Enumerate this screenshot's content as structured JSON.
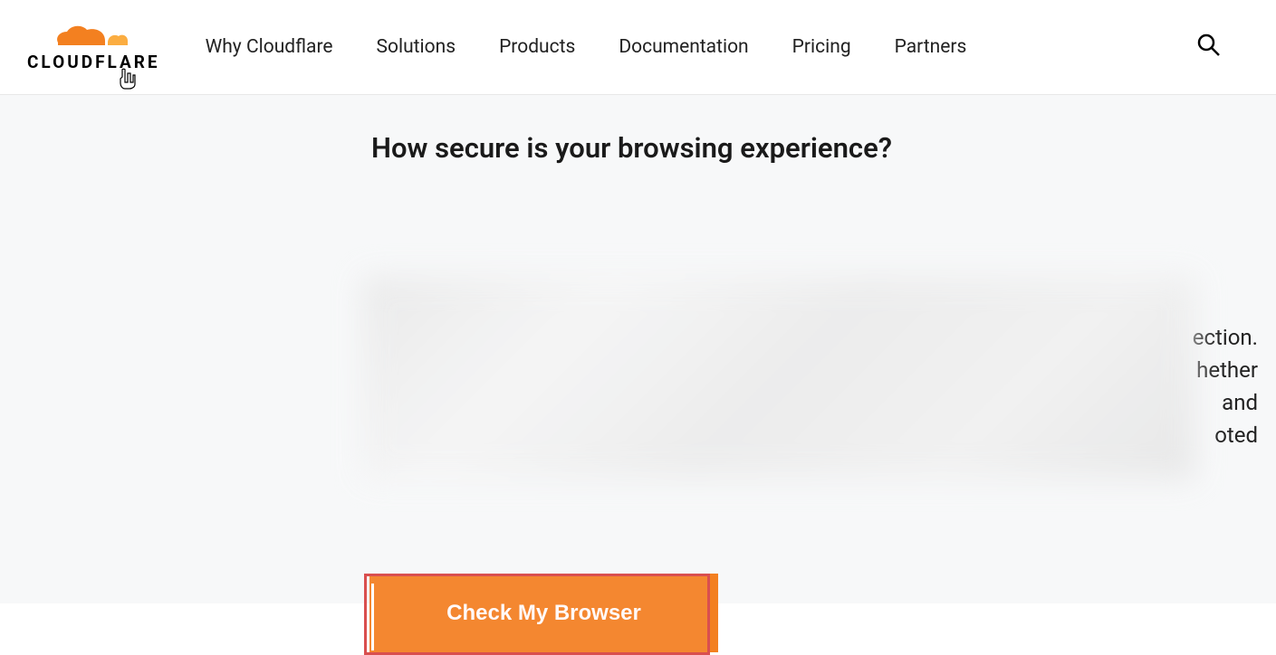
{
  "header": {
    "logo_text": "CLOUDFLARE",
    "nav": [
      "Why Cloudflare",
      "Solutions",
      "Products",
      "Documentation",
      "Pricing",
      "Partners"
    ]
  },
  "main": {
    "heading": "How secure is your browsing experience?",
    "partial_lines": [
      "ection.",
      "hether",
      "and",
      "oted"
    ],
    "cta_label": "Check My Browser"
  },
  "colors": {
    "accent": "#f38020",
    "highlight_border": "#d94f4f"
  }
}
